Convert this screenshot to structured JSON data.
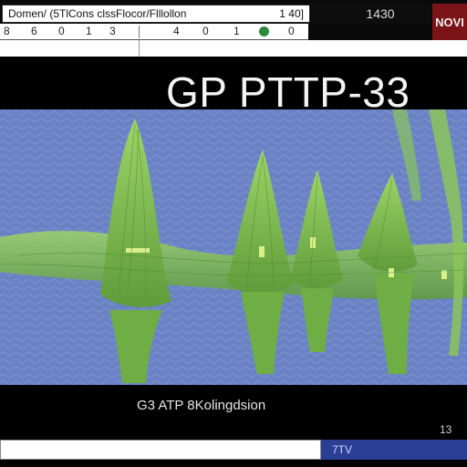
{
  "toolbar": {
    "url_text": "Domen/ (5TlCons clssFlocor/Flllollon",
    "url_suffix": "1 40]",
    "readout": "1430",
    "badge_label": "NOVI"
  },
  "ruler": {
    "ticks": [
      "8",
      "6",
      "0",
      "1",
      "3",
      "4",
      "0",
      "1",
      "0",
      "0"
    ]
  },
  "page": {
    "title": "GP PTTP-33",
    "caption": "G3 ATP 8Kolingdsion",
    "corner_number": "13"
  },
  "footer": {
    "button_label": "7TV"
  },
  "colors": {
    "viewer_bg": "#6a82c4",
    "structure_green": "#7fbf4d",
    "badge_red": "#7a1418",
    "button_blue": "#2a3f94"
  }
}
